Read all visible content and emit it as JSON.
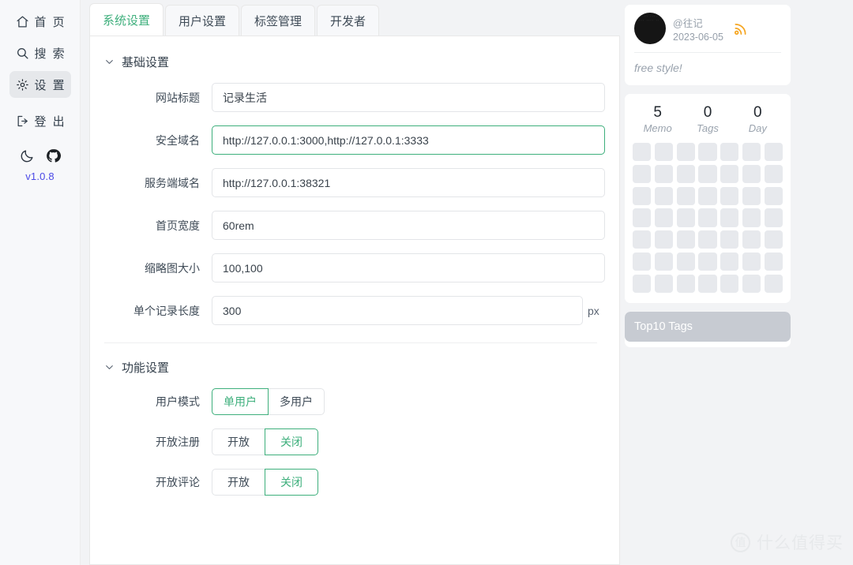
{
  "sidebar": {
    "items": [
      {
        "label": "首 页",
        "icon": "home-icon",
        "active": false
      },
      {
        "label": "搜 索",
        "icon": "search-icon",
        "active": false
      },
      {
        "label": "设 置",
        "icon": "gear-icon",
        "active": true
      },
      {
        "label": "登 出",
        "icon": "logout-icon",
        "active": false
      }
    ],
    "dark_mode_icon": "moon-icon",
    "github_icon": "github-icon",
    "version": "v1.0.8"
  },
  "tabs": [
    {
      "label": "系统设置",
      "active": true
    },
    {
      "label": "用户设置",
      "active": false
    },
    {
      "label": "标签管理",
      "active": false
    },
    {
      "label": "开发者",
      "active": false
    }
  ],
  "sections": [
    {
      "title": "基础设置",
      "fields": [
        {
          "label": "网站标题",
          "value": "记录生活",
          "focused": false,
          "suffix": ""
        },
        {
          "label": "安全域名",
          "value": "http://127.0.0.1:3000,http://127.0.0.1:3333",
          "focused": true,
          "suffix": ""
        },
        {
          "label": "服务端域名",
          "value": "http://127.0.0.1:38321",
          "focused": false,
          "suffix": ""
        },
        {
          "label": "首页宽度",
          "value": "60rem",
          "focused": false,
          "suffix": ""
        },
        {
          "label": "缩略图大小",
          "value": "100,100",
          "focused": false,
          "suffix": ""
        },
        {
          "label": "单个记录长度",
          "value": "300",
          "focused": false,
          "suffix": "px"
        }
      ]
    },
    {
      "title": "功能设置",
      "toggles": [
        {
          "label": "用户模式",
          "options": [
            "单用户",
            "多用户"
          ],
          "selected": 0
        },
        {
          "label": "开放注册",
          "options": [
            "开放",
            "关闭"
          ],
          "selected": 1
        },
        {
          "label": "开放评论",
          "options": [
            "开放",
            "关闭"
          ],
          "selected": 1
        }
      ]
    }
  ],
  "right_panel": {
    "user": {
      "name": "@往记",
      "date": "2023-06-05",
      "rss_icon": "rss-icon",
      "tagline": "free style!"
    },
    "stats": [
      {
        "value": "5",
        "label": "Memo"
      },
      {
        "value": "0",
        "label": "Tags"
      },
      {
        "value": "0",
        "label": "Day"
      }
    ],
    "heatmap": {
      "rows": 7,
      "cols": 7,
      "empty_color": "#e7e9ed"
    },
    "tags_panel": {
      "title": "Top10 Tags"
    }
  },
  "watermark": {
    "logo_char": "值",
    "text": "什么值得买"
  },
  "colors": {
    "accent_green": "#3eaf7c",
    "version_blue": "#4b49e6",
    "rss_orange": "#f5a623",
    "page_bg": "#f2f3f5",
    "tags_header": "#c7cbd2"
  }
}
